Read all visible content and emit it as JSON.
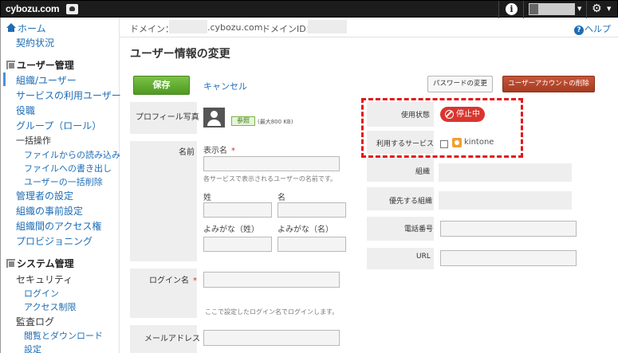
{
  "topbar": {
    "logo": "cybozu.com",
    "info_glyph": "i",
    "user_caret": "▼",
    "gear_glyph": "⚙",
    "gear_caret": "▼"
  },
  "sidebar": {
    "home": "ホーム",
    "contract": "契約状況",
    "user_mgmt_head": "ユーザー管理",
    "org_users": "組織/ユーザー",
    "service_users": "サービスの利用ユーザー",
    "roles": "役職",
    "groups": "グループ（ロール）",
    "bulk_ops": "一括操作",
    "import_file": "ファイルからの読み込み",
    "export_file": "ファイルへの書き出し",
    "bulk_delete": "ユーザーの一括削除",
    "admin_settings": "管理者の設定",
    "org_presettings": "組織の事前設定",
    "inter_org_access": "組織間のアクセス権",
    "provisioning": "プロビジョニング",
    "system_head": "システム管理",
    "security": "セキュリティ",
    "login": "ログイン",
    "access_limit": "アクセス制限",
    "audit_log": "監査ログ",
    "view_download": "閲覧とダウンロード",
    "settings": "設定"
  },
  "domainbar": {
    "domain_label": "ドメイン：",
    "domain_suffix": ".cybozu.com",
    "domain_id_label": "ドメインID："
  },
  "help": {
    "label": "ヘルプ",
    "glyph": "?"
  },
  "page": {
    "title": "ユーザー情報の変更"
  },
  "actions": {
    "save": "保存",
    "cancel": "キャンセル",
    "change_password": "パスワードの変更",
    "delete_user": "ユーザーアカウントの削除"
  },
  "form": {
    "profile_photo_label": "プロフィール写真",
    "browse_button": "参照",
    "max_size": "(最大800 KB)",
    "name_label": "名前",
    "display_name_label": "表示名",
    "required_mark": "*",
    "display_name_hint": "各サービスで表示されるユーザーの名前です。",
    "last_name": "姓",
    "first_name": "名",
    "last_name_kana": "よみがな（姓）",
    "first_name_kana": "よみがな（名）",
    "login_name_label": "ログイン名",
    "login_name_hint": "ここで設定したログイン名でログインします。",
    "email_label": "メールアドレス",
    "usage_status_label": "使用状態",
    "usage_status_value": "停止中",
    "services_label": "利用するサービス",
    "service_kintone": "kintone",
    "org_label": "組織",
    "priority_org_label": "優先する組織",
    "phone_label": "電話番号",
    "url_label": "URL"
  },
  "colors": {
    "accent": "#1e6db5",
    "save_green": "#5ea82f",
    "delete_red": "#b3462b",
    "status_red": "#d8362f",
    "highlight_red": "#e3171b"
  }
}
